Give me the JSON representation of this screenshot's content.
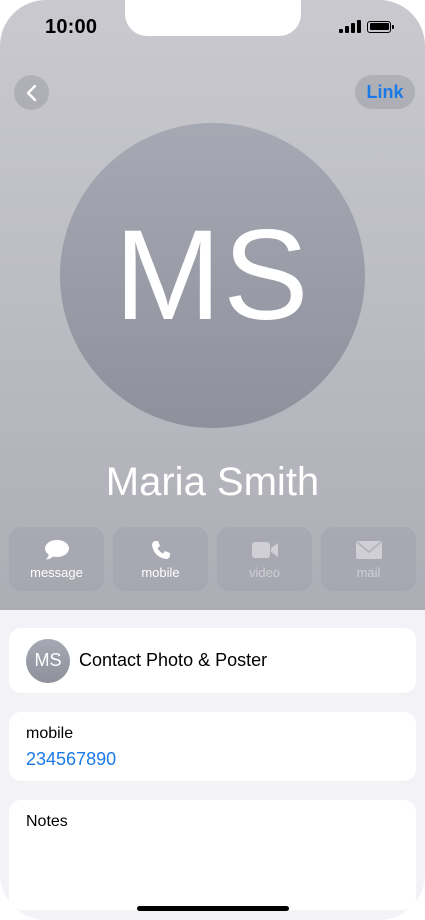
{
  "status_bar": {
    "time": "10:00"
  },
  "nav": {
    "back_icon": "chevron-left-icon",
    "link_label": "Link"
  },
  "contact": {
    "initials": "MS",
    "name": "Maria Smith"
  },
  "actions": [
    {
      "label": "message",
      "icon": "message-bubble-icon",
      "enabled": true
    },
    {
      "label": "mobile",
      "icon": "phone-icon",
      "enabled": true
    },
    {
      "label": "video",
      "icon": "video-camera-icon",
      "enabled": false
    },
    {
      "label": "mail",
      "icon": "envelope-icon",
      "enabled": false
    }
  ],
  "photo_card": {
    "initials": "MS",
    "label": "Contact Photo & Poster"
  },
  "phone_card": {
    "label": "mobile",
    "number": "234567890"
  },
  "notes_card": {
    "label": "Notes"
  },
  "colors": {
    "accent": "#1a7ae6",
    "avatar": "#9a9ca7",
    "background": "#f2f2f7"
  }
}
